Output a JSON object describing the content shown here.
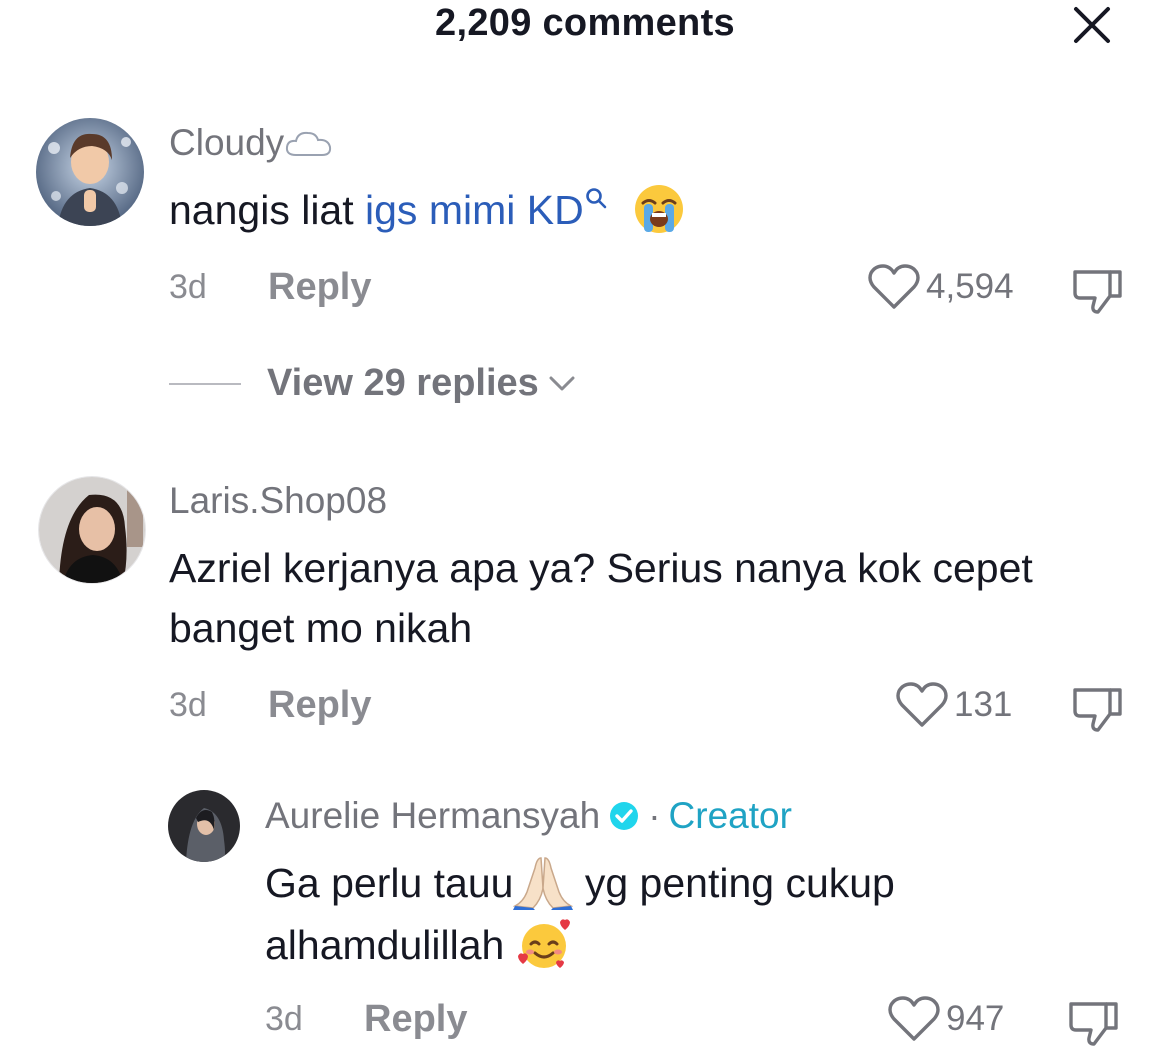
{
  "header": {
    "title": "2,209 comments",
    "close_icon": "close-icon"
  },
  "comments": [
    {
      "username": "Cloudy",
      "username_icon": "cloud-icon",
      "text_before": "nangis liat ",
      "search_link": "igs mimi KD",
      "search_icon": "search-icon",
      "emoji": "loudly-crying-face-emoji",
      "time": "3d",
      "reply_label": "Reply",
      "likes": "4,594",
      "view_replies": "View 29 replies"
    },
    {
      "username": "Laris.Shop08",
      "text": "Azriel kerjanya apa ya? Serius nanya kok cepet banget mo nikah",
      "time": "3d",
      "reply_label": "Reply",
      "likes": "131"
    }
  ],
  "reply": {
    "username": "Aurelie Hermansyah",
    "verified_icon": "verified-icon",
    "separator": "·",
    "badge": "Creator",
    "text_part1": "Ga perlu tauu",
    "emoji1": "folded-hands-emoji",
    "text_part2": " yg penting cukup alhamdulillah ",
    "emoji2": "smiling-face-with-hearts-emoji",
    "time": "3d",
    "reply_label": "Reply",
    "likes": "947"
  },
  "colors": {
    "text": "#161823",
    "muted": "#73747b",
    "link": "#2b5db9",
    "creator": "#1fa3c4",
    "verified": "#20d5ec"
  }
}
